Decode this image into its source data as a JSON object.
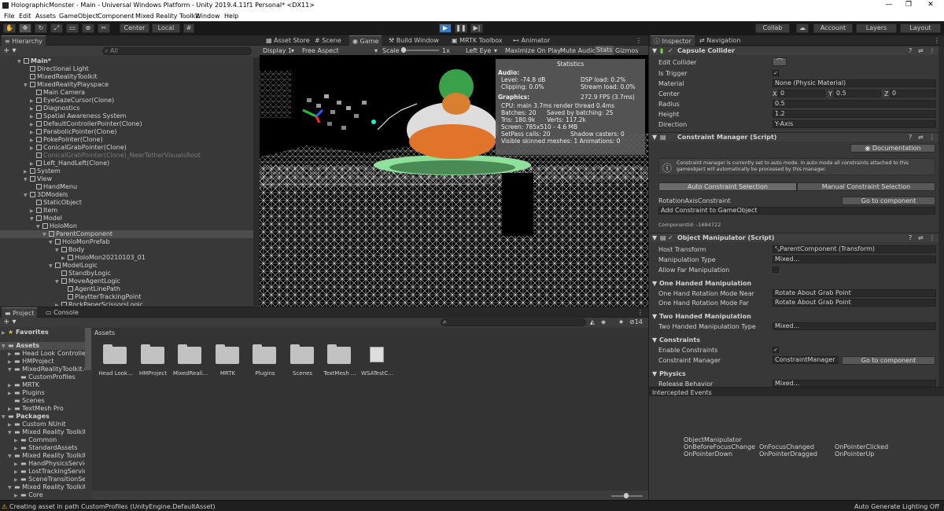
{
  "window": {
    "title": "HolographicMonster - Main - Universal Windows Platform - Unity 2019.4.11f1 Personal* <DX11>"
  },
  "menu": [
    "File",
    "Edit",
    "Assets",
    "GameObject",
    "Component",
    "Mixed Reality Toolkit",
    "Window",
    "Help"
  ],
  "toolbar": {
    "pivot": "Center",
    "space": "Local",
    "collab": "Collab",
    "account": "Account",
    "layers": "Layers",
    "layout": "Layout"
  },
  "hierarchy": {
    "tab": "Hierarchy",
    "search_placeholder": "All",
    "items": [
      {
        "label": "Main*",
        "depth": 0,
        "arrow": "▼"
      },
      {
        "label": "Directional Light",
        "depth": 1,
        "arrow": ""
      },
      {
        "label": "MixedRealityToolkit",
        "depth": 1,
        "arrow": ""
      },
      {
        "label": "MixedRealityPlayspace",
        "depth": 1,
        "arrow": "▼"
      },
      {
        "label": "Main Camera",
        "depth": 2,
        "arrow": ""
      },
      {
        "label": "EyeGazeCursor(Clone)",
        "depth": 2,
        "arrow": "▶"
      },
      {
        "label": "Diagnostics",
        "depth": 2,
        "arrow": "▶"
      },
      {
        "label": "Spatial Awareness System",
        "depth": 2,
        "arrow": "▶"
      },
      {
        "label": "DefaultControllerPointer(Clone)",
        "depth": 2,
        "arrow": "▶"
      },
      {
        "label": "ParabolicPointer(Clone)",
        "depth": 2,
        "arrow": "▶"
      },
      {
        "label": "PokePointer(Clone)",
        "depth": 2,
        "arrow": "▶"
      },
      {
        "label": "ConicalGrabPointer(Clone)",
        "depth": 2,
        "arrow": "▶"
      },
      {
        "label": "ConicalGrabPointer(Clone)_NearTetherVisualsRoot",
        "depth": 2,
        "arrow": "",
        "dim": true
      },
      {
        "label": "Left_HandLeft(Clone)",
        "depth": 2,
        "arrow": "▶"
      },
      {
        "label": "System",
        "depth": 1,
        "arrow": "▶"
      },
      {
        "label": "View",
        "depth": 1,
        "arrow": "▼"
      },
      {
        "label": "HandMenu",
        "depth": 2,
        "arrow": ""
      },
      {
        "label": "3DModels",
        "depth": 1,
        "arrow": "▼"
      },
      {
        "label": "StaticObject",
        "depth": 2,
        "arrow": ""
      },
      {
        "label": "Item",
        "depth": 2,
        "arrow": "▶"
      },
      {
        "label": "Model",
        "depth": 2,
        "arrow": "▼"
      },
      {
        "label": "HoloMon",
        "depth": 3,
        "arrow": "▼"
      },
      {
        "label": "ParentComponent",
        "depth": 4,
        "arrow": "▼",
        "sel": true
      },
      {
        "label": "HoloMonPrefab",
        "depth": 5,
        "arrow": "▼"
      },
      {
        "label": "Body",
        "depth": 6,
        "arrow": "▼"
      },
      {
        "label": "HoloMon20210103_01",
        "depth": 7,
        "arrow": "▶"
      },
      {
        "label": "ModelLogic",
        "depth": 5,
        "arrow": "▼"
      },
      {
        "label": "StandbyLogic",
        "depth": 6,
        "arrow": ""
      },
      {
        "label": "MoveAgentLogic",
        "depth": 6,
        "arrow": "▼"
      },
      {
        "label": "AgentLinePath",
        "depth": 7,
        "arrow": ""
      },
      {
        "label": "PlaytterTrackingPoint",
        "depth": 7,
        "arrow": ""
      },
      {
        "label": "RockPaperScissorsLogic",
        "depth": 6,
        "arrow": "▶"
      }
    ]
  },
  "scene_tabs": [
    "Asset Store",
    "Scene",
    "Game",
    "Build Window",
    "MRTK Toolbox",
    "Animator"
  ],
  "game_bar": {
    "display": "Display 1",
    "aspect": "Free Aspect",
    "scale_label": "Scale",
    "scale_value": "1x",
    "eye": "Left Eye",
    "max": "Maximize On Play",
    "mute": "Mute Audio",
    "stats": "Stats",
    "gizmos": "Gizmos"
  },
  "stats": {
    "title": "Statistics",
    "audio": "Audio:",
    "level": "Level: -74.8 dB",
    "clipping": "Clipping: 0.0%",
    "dsp": "DSP load: 0.2%",
    "stream": "Stream load: 0.0%",
    "graphics": "Graphics:",
    "fps": "272.9 FPS (3.7ms)",
    "cpu": "CPU: main 3.7ms  render thread 0.4ms",
    "batches": "Batches: 20",
    "saved": "Saved by batching: 25",
    "tris": "Tris: 180.9k",
    "verts": "Verts: 117.2k",
    "screen": "Screen: 785x510 - 4.6 MB",
    "setpass": "SetPass calls: 20",
    "shadow": "Shadow casters: 0",
    "skinned": "Visible skinned meshes: 1  Animations: 0"
  },
  "project": {
    "tabs": [
      "Project",
      "Console"
    ],
    "count": "14",
    "favorites": "Favorites",
    "assets_header": "Assets",
    "tree": [
      {
        "label": "Assets",
        "depth": 0,
        "arrow": "▼",
        "bold": true
      },
      {
        "label": "Head Look Controller",
        "depth": 1,
        "arrow": "▶"
      },
      {
        "label": "HMProject",
        "depth": 1,
        "arrow": "▶"
      },
      {
        "label": "MixedRealityToolkit.G",
        "depth": 1,
        "arrow": "▼"
      },
      {
        "label": "CustomProfiles",
        "depth": 2,
        "arrow": ""
      },
      {
        "label": "MRTK",
        "depth": 1,
        "arrow": "▶"
      },
      {
        "label": "Plugins",
        "depth": 1,
        "arrow": "▶"
      },
      {
        "label": "Scenes",
        "depth": 1,
        "arrow": ""
      },
      {
        "label": "TextMesh Pro",
        "depth": 1,
        "arrow": "▶"
      },
      {
        "label": "Packages",
        "depth": 0,
        "arrow": "▼",
        "bold": true
      },
      {
        "label": "Custom NUnit",
        "depth": 1,
        "arrow": "▶"
      },
      {
        "label": "Mixed Reality Toolkit E",
        "depth": 1,
        "arrow": "▼"
      },
      {
        "label": "Common",
        "depth": 2,
        "arrow": "▶"
      },
      {
        "label": "StandardAssets",
        "depth": 2,
        "arrow": "▶"
      },
      {
        "label": "Mixed Reality Toolkit E",
        "depth": 1,
        "arrow": "▼"
      },
      {
        "label": "HandPhysicsServic",
        "depth": 2,
        "arrow": "▶"
      },
      {
        "label": "LostTrackingServic",
        "depth": 2,
        "arrow": "▶"
      },
      {
        "label": "SceneTransitionSer",
        "depth": 2,
        "arrow": "▶"
      },
      {
        "label": "Mixed Reality Toolkit F",
        "depth": 1,
        "arrow": "▼"
      },
      {
        "label": "Core",
        "depth": 2,
        "arrow": "▶"
      }
    ],
    "assets": [
      "Head Look...",
      "HMProject",
      "MixedReali...",
      "MRTK",
      "Plugins",
      "Scenes",
      "TextMesh ...",
      "WSATestC..."
    ]
  },
  "inspector": {
    "tabs": [
      "Inspector",
      "Navigation"
    ],
    "capsule": {
      "title": "Capsule Collider",
      "edit": "Edit Collider",
      "is_trigger": "Is Trigger",
      "material": "Material",
      "material_v": "None (Physic Material)",
      "center": "Center",
      "cx": "0",
      "cy": "0.5",
      "cz": "0",
      "radius": "Radius",
      "radius_v": "0.5",
      "height": "Height",
      "height_v": "1.2",
      "direction": "Direction",
      "direction_v": "Y-Axis"
    },
    "cm": {
      "title": "Constraint Manager (Script)",
      "doc": "Documentation",
      "info": "Constraint manager is currently set to auto mode. In auto mode all constraints attached to this gameobject will automatically be processed by this manager.",
      "auto": "Auto Constraint Selection",
      "manual": "Manual Constraint Selection",
      "rot": "RotationAxisConstraint",
      "goto": "Go to component",
      "add": "Add Constraint to GameObject",
      "cid": "ComponentId: -1684722"
    },
    "om": {
      "title": "Object Manipulator (Script)",
      "host": "Host Transform",
      "host_v": "ParentComponent (Transform)",
      "mtype": "Manipulation Type",
      "mtype_v": "Mixed...",
      "far": "Allow Far Manipulation",
      "oh": "One Handed Manipulation",
      "ohn": "One Hand Rotation Mode Near",
      "ohn_v": "Rotate About Grab Point",
      "ohf": "One Hand Rotation Mode Far",
      "ohf_v": "Rotate About Grab Point",
      "th": "Two Handed Manipulation",
      "tht": "Two Handed Manipulation Type",
      "tht_v": "Mixed...",
      "cons": "Constraints",
      "enable": "Enable Constraints",
      "cmgr": "Constraint Manager",
      "cmgr_v": "ConstraintManager (C",
      "goto": "Go to component",
      "phys": "Physics",
      "rel": "Release Behavior",
      "rel_v": "Mixed..."
    },
    "events": {
      "header": "Intercepted Events",
      "title": "ObjectManipulator",
      "items": [
        "OnBeforeFocusChange",
        "OnFocusChanged",
        "OnPointerClicked",
        "OnPointerDown",
        "OnPointerDragged",
        "OnPointerUp"
      ]
    }
  },
  "status": {
    "left": "Creating asset in path CustomProfiles (UnityEngine.DefaultAsset)",
    "right": "Auto Generate Lighting Off"
  }
}
